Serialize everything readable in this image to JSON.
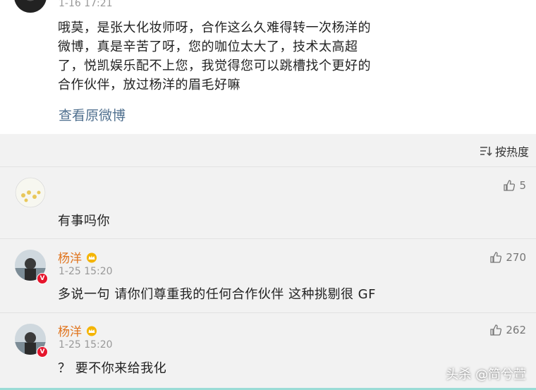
{
  "post": {
    "time": "1-16 17:21",
    "lines": [
      "哦莫，是张大化妆师呀，合作这么久难得转一次杨洋的",
      "微博，真是辛苦了呀，您的咖位太大了，技术太高超",
      "了，悦凯娱乐配不上您，我觉得您可以跳槽找个更好的",
      "合作伙伴，放过杨洋的眉毛好嘛"
    ],
    "view_original": "查看原微博"
  },
  "sort": {
    "label": "按热度",
    "icon": "sort-icon"
  },
  "comments": [
    {
      "name": "",
      "time": "",
      "text": "有事吗你",
      "likes": "5"
    },
    {
      "name": "杨洋",
      "time": "1-25 15:20",
      "text": "多说一句 请你们尊重我的任何合作伙伴 这种挑剔很 GF",
      "likes": "270"
    },
    {
      "name": "杨洋",
      "time": "1-25 15:20",
      "text": "？ 要不你来给我化",
      "likes": "262"
    }
  ],
  "watermark": "头杀 @简兮萱",
  "colors": {
    "name": "#e0741d",
    "link": "#50708f",
    "verify": "#e6162d"
  }
}
